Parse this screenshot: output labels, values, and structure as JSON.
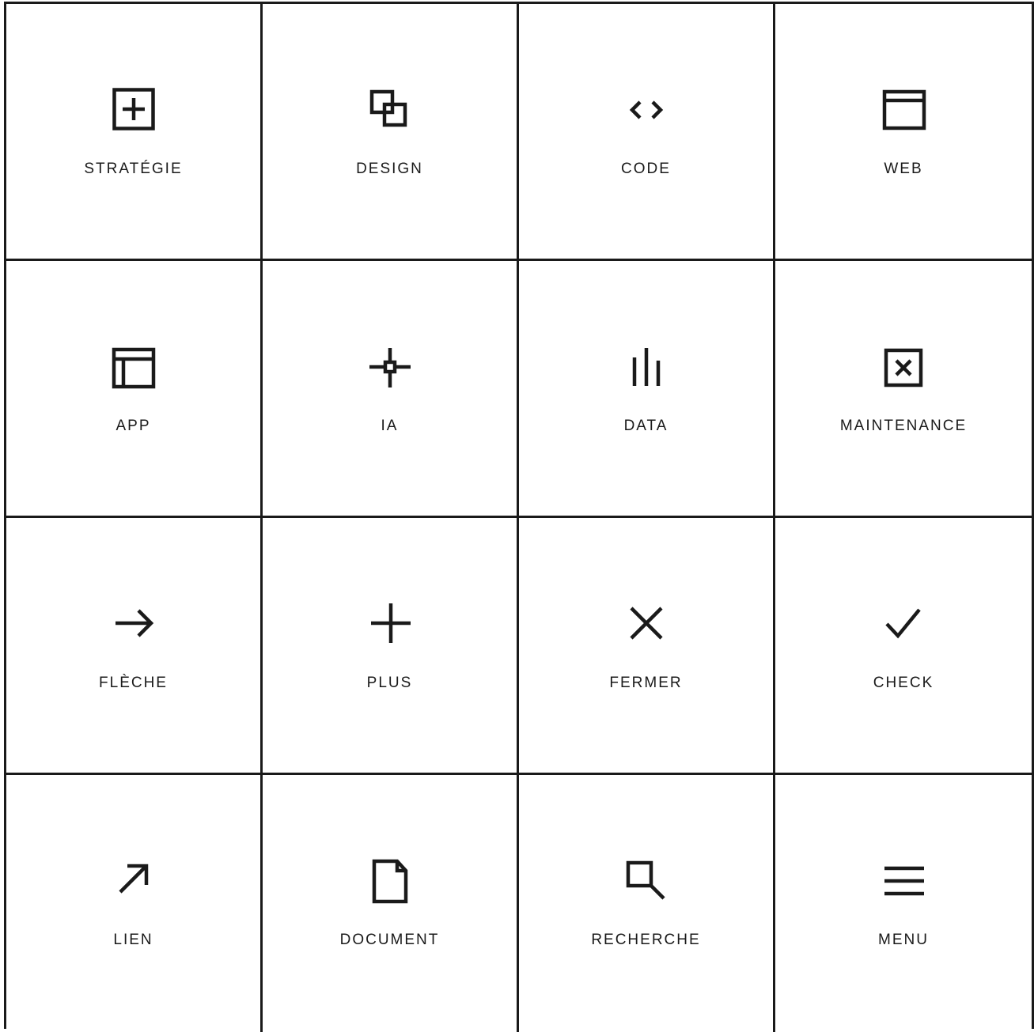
{
  "tiles": [
    {
      "label": "STRATÉGIE",
      "icon": "strategy-icon"
    },
    {
      "label": "DESIGN",
      "icon": "design-icon"
    },
    {
      "label": "CODE",
      "icon": "code-icon"
    },
    {
      "label": "WEB",
      "icon": "web-icon"
    },
    {
      "label": "APP",
      "icon": "app-icon"
    },
    {
      "label": "IA",
      "icon": "ai-icon"
    },
    {
      "label": "DATA",
      "icon": "data-icon"
    },
    {
      "label": "MAINTENANCE",
      "icon": "maintenance-icon"
    },
    {
      "label": "FLÈCHE",
      "icon": "arrow-right-icon"
    },
    {
      "label": "PLUS",
      "icon": "plus-icon"
    },
    {
      "label": "FERMER",
      "icon": "close-icon"
    },
    {
      "label": "CHECK",
      "icon": "check-icon"
    },
    {
      "label": "LIEN",
      "icon": "link-arrow-icon"
    },
    {
      "label": "DOCUMENT",
      "icon": "document-icon"
    },
    {
      "label": "RECHERCHE",
      "icon": "search-icon"
    },
    {
      "label": "MENU",
      "icon": "menu-icon"
    }
  ],
  "colors": {
    "stroke": "#1a1a1a",
    "background": "#ffffff"
  }
}
